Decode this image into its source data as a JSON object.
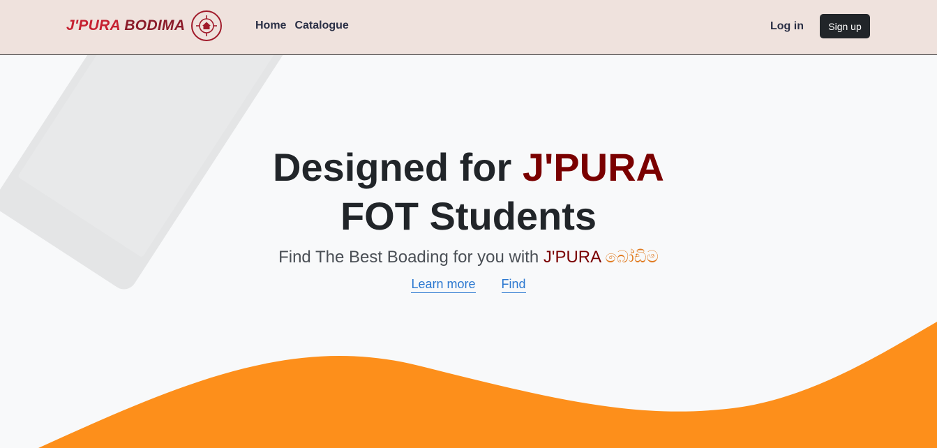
{
  "brand": {
    "part1": "J'PURA",
    "part2": "BODIMA",
    "logo_icon": "house-target-icon",
    "colors": {
      "primary": "#c62030",
      "dark": "#8b1c2a"
    }
  },
  "nav": {
    "items": [
      {
        "label": "Home"
      },
      {
        "label": "Catalogue"
      }
    ],
    "login_label": "Log in",
    "signup_label": "Sign up"
  },
  "hero": {
    "title_part1": "Designed for",
    "title_accent": "J'PURA",
    "title_part2": "FOT Students",
    "subtitle_prefix": "Find The Best Boading for you with",
    "subtitle_accent": "J'PURA",
    "subtitle_sinhala": "බෝඩිම",
    "links": [
      {
        "label": "Learn more"
      },
      {
        "label": "Find"
      }
    ]
  },
  "colors": {
    "navbar_bg": "#efe2dd",
    "accent_red": "#7a0000",
    "wave_orange": "#fd8f1b",
    "link_blue": "#2b78d0"
  }
}
